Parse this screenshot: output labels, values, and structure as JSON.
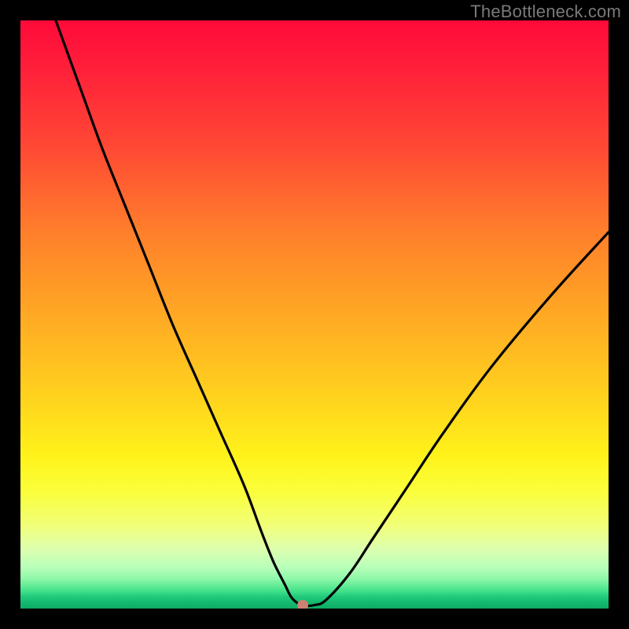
{
  "watermark": "TheBottleneck.com",
  "chart_data": {
    "type": "line",
    "title": "",
    "xlabel": "",
    "ylabel": "",
    "xlim": [
      0,
      100
    ],
    "ylim": [
      0,
      100
    ],
    "grid": false,
    "legend": false,
    "series": [
      {
        "name": "bottleneck-curve",
        "x": [
          6,
          10,
          14,
          18,
          22,
          26,
          30,
          34,
          38,
          41,
          43,
          45,
          46,
          47,
          48,
          50,
          52,
          56,
          60,
          66,
          72,
          80,
          90,
          100
        ],
        "y": [
          100,
          89,
          78,
          68,
          58,
          48,
          39,
          30,
          21,
          13,
          8,
          4,
          2,
          1,
          0.5,
          0.6,
          1.5,
          6,
          12,
          21,
          30,
          41,
          53,
          64
        ]
      }
    ],
    "marker": {
      "x": 48,
      "y": 0.5,
      "color": "#d08072"
    },
    "background_gradient": {
      "direction": "vertical",
      "stops": [
        {
          "pos": 0.0,
          "color": "#ff0a3a"
        },
        {
          "pos": 0.36,
          "color": "#ff7f2b"
        },
        {
          "pos": 0.64,
          "color": "#ffd21e"
        },
        {
          "pos": 0.86,
          "color": "#f1ff7a"
        },
        {
          "pos": 0.97,
          "color": "#42e28a"
        },
        {
          "pos": 1.0,
          "color": "#0faa66"
        }
      ]
    }
  }
}
